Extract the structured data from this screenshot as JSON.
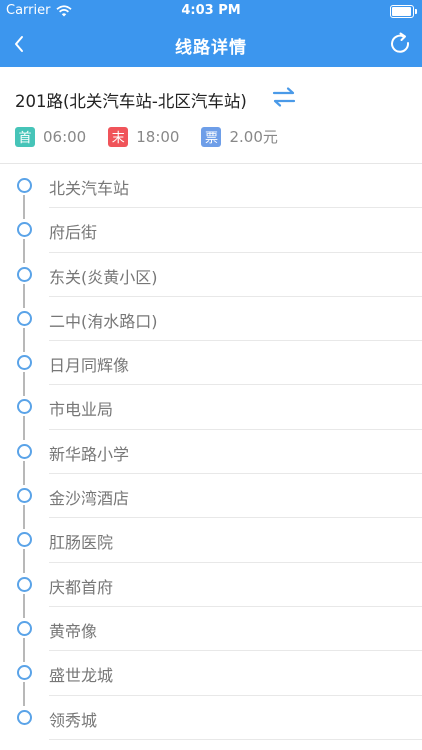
{
  "status_bar": {
    "carrier": "Carrier",
    "time": "4:03 PM",
    "battery_level": 0.95
  },
  "nav": {
    "title": "线路详情",
    "back_icon": "chevron-left-icon",
    "refresh_icon": "refresh-icon"
  },
  "route": {
    "name": "201路(北关汽车站-北区汽车站)",
    "first_tag": "首",
    "first_time": "06:00",
    "last_tag": "末",
    "last_time": "18:00",
    "fare_tag": "票",
    "fare": "2.00元"
  },
  "colors": {
    "header": "#3c96ee",
    "first_tag": "#46c4b8",
    "last_tag": "#f0545a",
    "fare_tag": "#6e9ee8",
    "stop_node": "#5aa3e8"
  },
  "stops": [
    "北关汽车站",
    "府后街",
    "东关(炎黄小区)",
    "二中(洧水路口)",
    "日月同辉像",
    "市电业局",
    "新华路小学",
    "金沙湾酒店",
    "肛肠医院",
    "庆都首府",
    "黄帝像",
    "盛世龙城",
    "领秀城"
  ]
}
